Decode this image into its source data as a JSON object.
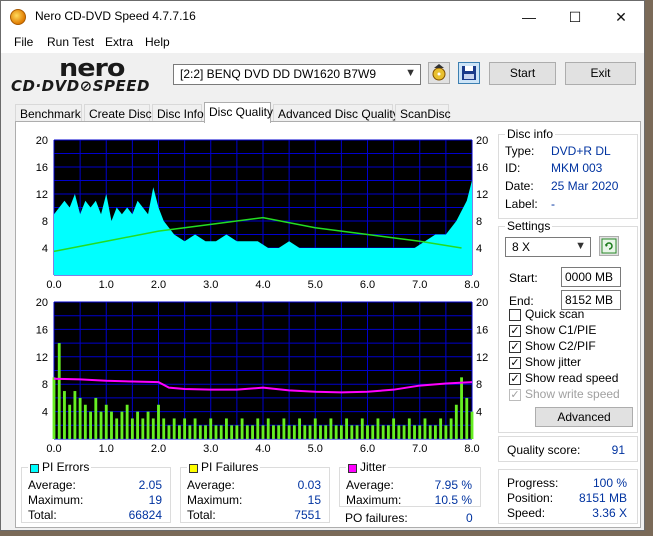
{
  "window": {
    "title": "Nero CD-DVD Speed 4.7.7.16",
    "minimize": "—",
    "maximize": "☐",
    "close": "✕"
  },
  "menu": [
    "File",
    "Run Test",
    "Extra",
    "Help"
  ],
  "logo": {
    "top": "nero",
    "bottom": "CD·DVD⊘SPEED"
  },
  "drive": {
    "value": "[2:2]   BENQ DVD DD DW1620 B7W9"
  },
  "buttons": {
    "start": "Start",
    "exit": "Exit",
    "advanced": "Advanced"
  },
  "tabs": [
    "Benchmark",
    "Create Disc",
    "Disc Info",
    "Disc Quality",
    "Advanced Disc Quality",
    "ScanDisc"
  ],
  "active_tab": "Disc Quality",
  "disc_info": {
    "caption": "Disc info",
    "type_label": "Type:",
    "type": "DVD+R DL",
    "id_label": "ID:",
    "id": "MKM 003",
    "date_label": "Date:",
    "date": "25 Mar 2020",
    "label_label": "Label:",
    "label": "-"
  },
  "settings": {
    "caption": "Settings",
    "speed": "8 X",
    "start_label": "Start:",
    "start": "0000 MB",
    "end_label": "End:",
    "end": "8152 MB",
    "quick_scan": "Quick scan",
    "show_c1": "Show C1/PIE",
    "show_c2": "Show C2/PIF",
    "show_jitter": "Show jitter",
    "show_read": "Show read speed",
    "show_write": "Show write speed"
  },
  "quality": {
    "label": "Quality score:",
    "value": "91"
  },
  "progress": {
    "progress_label": "Progress:",
    "progress": "100 %",
    "position_label": "Position:",
    "position": "8151 MB",
    "speed_label": "Speed:",
    "speed": "3.36 X"
  },
  "pi_errors": {
    "caption": "PI Errors",
    "avg_label": "Average:",
    "avg": "2.05",
    "max_label": "Maximum:",
    "max": "19",
    "total_label": "Total:",
    "total": "66824"
  },
  "pi_failures": {
    "caption": "PI Failures",
    "avg_label": "Average:",
    "avg": "0.03",
    "max_label": "Maximum:",
    "max": "15",
    "total_label": "Total:",
    "total": "7551"
  },
  "jitter": {
    "caption": "Jitter",
    "avg_label": "Average:",
    "avg": "7.95 %",
    "max_label": "Maximum:",
    "max": "10.5 %",
    "po_label": "PO failures:",
    "po": "0"
  },
  "colors": {
    "pi_errors": "#00ffff",
    "pi_failures": "#ffff00",
    "jitter": "#ff00ff",
    "read_speed": "#22dd22",
    "plot_bg": "#000000",
    "grid": "#0000cc"
  },
  "chart_data": [
    {
      "type": "area",
      "xlim": [
        0,
        8
      ],
      "ylim": [
        0,
        20
      ],
      "x_ticks": [
        "0.0",
        "1.0",
        "2.0",
        "3.0",
        "4.0",
        "5.0",
        "6.0",
        "7.0",
        "8.0"
      ],
      "y_ticks_left": [
        "20",
        "16",
        "12",
        "8",
        "4"
      ],
      "y_ticks_right": [
        "20",
        "16",
        "12",
        "8",
        "4"
      ],
      "series": [
        {
          "values": [
            [
              0,
              9
            ],
            [
              0.1,
              10
            ],
            [
              0.2,
              11
            ],
            [
              0.3,
              10
            ],
            [
              0.4,
              12
            ],
            [
              0.5,
              9
            ],
            [
              0.6,
              11
            ],
            [
              0.7,
              10
            ],
            [
              0.8,
              11
            ],
            [
              0.9,
              9
            ],
            [
              1.0,
              12
            ],
            [
              1.1,
              8
            ],
            [
              1.2,
              10
            ],
            [
              1.3,
              9
            ],
            [
              1.4,
              10
            ],
            [
              1.5,
              9
            ],
            [
              1.6,
              11
            ],
            [
              1.7,
              10
            ],
            [
              1.8,
              9
            ],
            [
              1.9,
              13
            ],
            [
              2.0,
              10
            ],
            [
              2.1,
              8
            ],
            [
              2.2,
              7
            ],
            [
              2.3,
              6
            ],
            [
              2.5,
              5
            ],
            [
              2.7,
              6
            ],
            [
              2.9,
              5
            ],
            [
              3.1,
              5
            ],
            [
              3.3,
              6
            ],
            [
              3.5,
              5
            ],
            [
              3.7,
              5
            ],
            [
              3.9,
              5
            ],
            [
              4.1,
              4
            ],
            [
              4.3,
              4
            ],
            [
              4.5,
              5
            ],
            [
              4.7,
              4
            ],
            [
              4.9,
              4
            ],
            [
              5.1,
              4
            ],
            [
              5.3,
              4
            ],
            [
              5.5,
              4
            ],
            [
              5.7,
              4
            ],
            [
              5.9,
              4
            ],
            [
              6.1,
              4
            ],
            [
              6.3,
              4
            ],
            [
              6.5,
              4
            ],
            [
              6.7,
              4
            ],
            [
              6.9,
              4
            ],
            [
              7.1,
              5
            ],
            [
              7.3,
              6
            ],
            [
              7.5,
              6
            ],
            [
              7.7,
              8
            ],
            [
              7.9,
              11
            ],
            [
              8.0,
              14
            ]
          ]
        },
        {
          "values": [
            [
              0,
              3.5
            ],
            [
              1,
              5
            ],
            [
              2,
              6.5
            ],
            [
              3,
              7.5
            ],
            [
              4,
              8.5
            ],
            [
              5,
              7
            ],
            [
              6,
              6
            ],
            [
              7,
              5
            ],
            [
              7.8,
              4
            ]
          ]
        }
      ]
    },
    {
      "type": "bar",
      "xlim": [
        0,
        8
      ],
      "ylim": [
        0,
        20
      ],
      "x_ticks": [
        "0.0",
        "1.0",
        "2.0",
        "3.0",
        "4.0",
        "5.0",
        "6.0",
        "7.0",
        "8.0"
      ],
      "y_ticks_left": [
        "20",
        "16",
        "12",
        "8",
        "4"
      ],
      "y_ticks_right": [
        "20",
        "16",
        "12",
        "8",
        "4"
      ],
      "series": [
        {
          "values": [
            [
              0.0,
              9
            ],
            [
              0.1,
              14
            ],
            [
              0.2,
              7
            ],
            [
              0.3,
              5
            ],
            [
              0.4,
              7
            ],
            [
              0.5,
              6
            ],
            [
              0.6,
              5
            ],
            [
              0.7,
              4
            ],
            [
              0.8,
              6
            ],
            [
              0.9,
              4
            ],
            [
              1.0,
              5
            ],
            [
              1.1,
              4
            ],
            [
              1.2,
              3
            ],
            [
              1.3,
              4
            ],
            [
              1.4,
              5
            ],
            [
              1.5,
              3
            ],
            [
              1.6,
              4
            ],
            [
              1.7,
              3
            ],
            [
              1.8,
              4
            ],
            [
              1.9,
              3
            ],
            [
              2.0,
              5
            ],
            [
              2.1,
              3
            ],
            [
              2.2,
              2
            ],
            [
              2.3,
              3
            ],
            [
              2.4,
              2
            ],
            [
              2.5,
              3
            ],
            [
              2.6,
              2
            ],
            [
              2.7,
              3
            ],
            [
              2.8,
              2
            ],
            [
              2.9,
              2
            ],
            [
              3.0,
              3
            ],
            [
              3.1,
              2
            ],
            [
              3.2,
              2
            ],
            [
              3.3,
              3
            ],
            [
              3.4,
              2
            ],
            [
              3.5,
              2
            ],
            [
              3.6,
              3
            ],
            [
              3.7,
              2
            ],
            [
              3.8,
              2
            ],
            [
              3.9,
              3
            ],
            [
              4.0,
              2
            ],
            [
              4.1,
              3
            ],
            [
              4.2,
              2
            ],
            [
              4.3,
              2
            ],
            [
              4.4,
              3
            ],
            [
              4.5,
              2
            ],
            [
              4.6,
              2
            ],
            [
              4.7,
              3
            ],
            [
              4.8,
              2
            ],
            [
              4.9,
              2
            ],
            [
              5.0,
              3
            ],
            [
              5.1,
              2
            ],
            [
              5.2,
              2
            ],
            [
              5.3,
              3
            ],
            [
              5.4,
              2
            ],
            [
              5.5,
              2
            ],
            [
              5.6,
              3
            ],
            [
              5.7,
              2
            ],
            [
              5.8,
              2
            ],
            [
              5.9,
              3
            ],
            [
              6.0,
              2
            ],
            [
              6.1,
              2
            ],
            [
              6.2,
              3
            ],
            [
              6.3,
              2
            ],
            [
              6.4,
              2
            ],
            [
              6.5,
              3
            ],
            [
              6.6,
              2
            ],
            [
              6.7,
              2
            ],
            [
              6.8,
              3
            ],
            [
              6.9,
              2
            ],
            [
              7.0,
              2
            ],
            [
              7.1,
              3
            ],
            [
              7.2,
              2
            ],
            [
              7.3,
              2
            ],
            [
              7.4,
              3
            ],
            [
              7.5,
              2
            ],
            [
              7.6,
              3
            ],
            [
              7.7,
              5
            ],
            [
              7.8,
              9
            ],
            [
              7.9,
              6
            ],
            [
              8.0,
              4
            ]
          ]
        },
        {
          "values": [
            [
              0,
              8.8
            ],
            [
              0.5,
              8.7
            ],
            [
              1,
              8.5
            ],
            [
              1.5,
              8.4
            ],
            [
              2,
              8.3
            ],
            [
              2.2,
              7.5
            ],
            [
              2.5,
              7.3
            ],
            [
              3,
              7.2
            ],
            [
              3.5,
              7.2
            ],
            [
              4,
              7.5
            ],
            [
              4.5,
              7.1
            ],
            [
              5,
              6.9
            ],
            [
              5.5,
              6.8
            ],
            [
              6,
              6.9
            ],
            [
              6.5,
              7.2
            ],
            [
              7,
              7.8
            ],
            [
              7.5,
              8.1
            ],
            [
              8,
              8.3
            ]
          ]
        }
      ]
    }
  ]
}
